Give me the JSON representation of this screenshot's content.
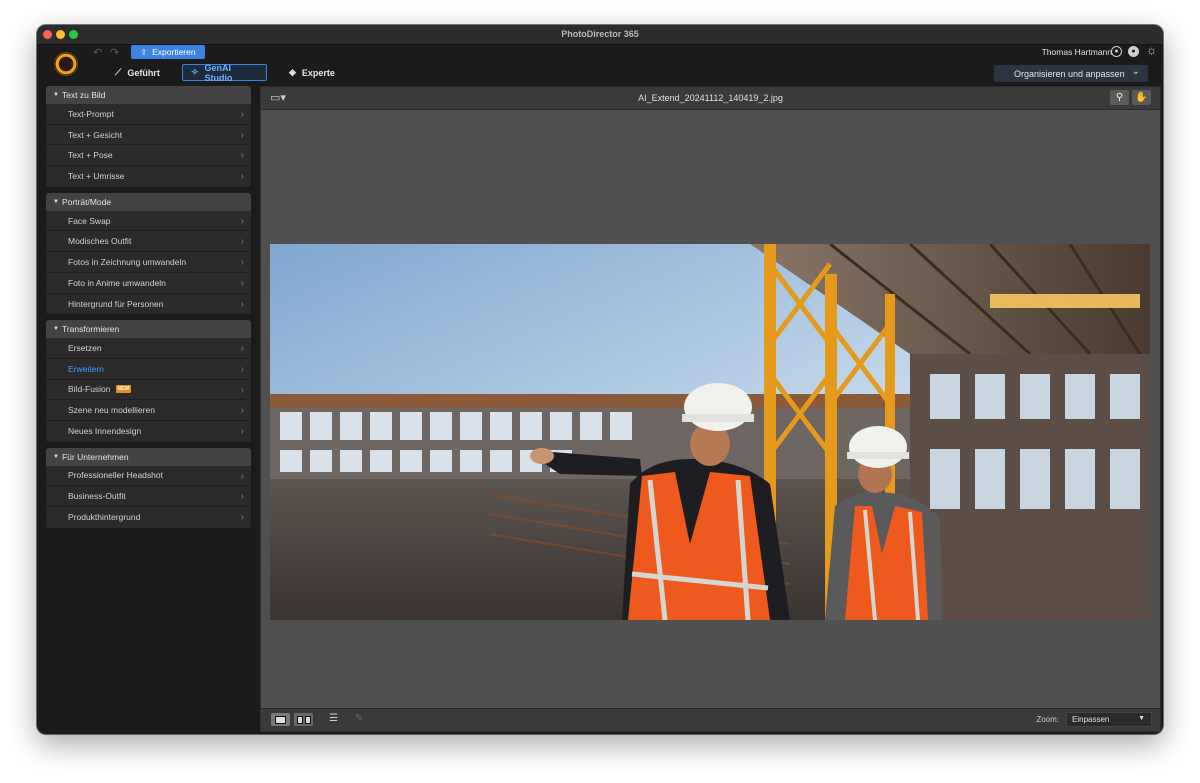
{
  "window": {
    "title": "PhotoDirector 365"
  },
  "toolbar": {
    "export_label": "Exportieren",
    "user_name": "Thomas Hartmann"
  },
  "modes": {
    "guided": "Geführt",
    "genai": "GenAI Studio",
    "expert": "Experte",
    "active": "genai"
  },
  "workspace_dropdown": {
    "value": "Organisieren und anpassen"
  },
  "sidebar": {
    "groups": [
      {
        "title": "Text zu Bild",
        "items": [
          {
            "label": "Text-Prompt"
          },
          {
            "label": "Text + Gesicht"
          },
          {
            "label": "Text + Pose"
          },
          {
            "label": "Text + Umrisse"
          }
        ]
      },
      {
        "title": "Porträt/Mode",
        "items": [
          {
            "label": "Face Swap"
          },
          {
            "label": "Modisches Outfit"
          },
          {
            "label": "Fotos in Zeichnung umwandeln"
          },
          {
            "label": "Foto in Anime umwandeln"
          },
          {
            "label": "Hintergrund für Personen"
          }
        ]
      },
      {
        "title": "Transformieren",
        "items": [
          {
            "label": "Ersetzen"
          },
          {
            "label": "Erweitern",
            "active": true
          },
          {
            "label": "Bild-Fusion",
            "badge": "NEW"
          },
          {
            "label": "Szene neu modellieren"
          },
          {
            "label": "Neues Innendesign"
          }
        ]
      },
      {
        "title": "Für Unternehmen",
        "items": [
          {
            "label": "Professioneller Headshot"
          },
          {
            "label": "Business-Outfit"
          },
          {
            "label": "Produkthintergrund"
          }
        ]
      }
    ]
  },
  "file_bar": {
    "filename": "AI_Extend_20241112_140419_2.jpg"
  },
  "bottom_bar": {
    "zoom_label": "Zoom:",
    "zoom_value": "Einpassen"
  },
  "photo": {
    "description_icon": "construction-site-photo"
  }
}
